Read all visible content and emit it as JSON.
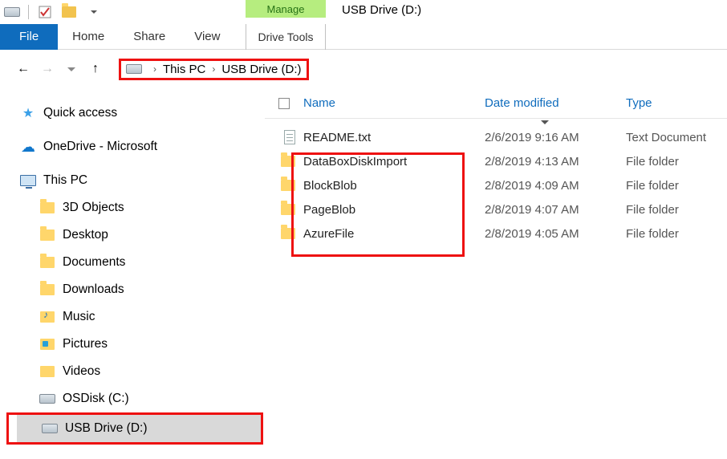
{
  "title": "USB Drive (D:)",
  "contextTab": {
    "label": "Manage",
    "group": "Drive Tools"
  },
  "ribbon": [
    "File",
    "Home",
    "Share",
    "View"
  ],
  "breadcrumb": [
    "This PC",
    "USB Drive (D:)"
  ],
  "columns": {
    "name": "Name",
    "date": "Date modified",
    "type": "Type"
  },
  "sidebar": {
    "quickAccess": "Quick access",
    "onedrive": "OneDrive - Microsoft",
    "thisPC": "This PC",
    "children": [
      "3D Objects",
      "Desktop",
      "Documents",
      "Downloads",
      "Music",
      "Pictures",
      "Videos",
      "OSDisk (C:)",
      "USB Drive (D:)"
    ]
  },
  "rows": [
    {
      "name": "README.txt",
      "date": "2/6/2019 9:16 AM",
      "type": "Text Document",
      "icon": "file"
    },
    {
      "name": "DataBoxDiskImport",
      "date": "2/8/2019 4:13 AM",
      "type": "File folder",
      "icon": "folder"
    },
    {
      "name": "BlockBlob",
      "date": "2/8/2019 4:09 AM",
      "type": "File folder",
      "icon": "folder"
    },
    {
      "name": "PageBlob",
      "date": "2/8/2019 4:07 AM",
      "type": "File folder",
      "icon": "folder"
    },
    {
      "name": "AzureFile",
      "date": "2/8/2019 4:05 AM",
      "type": "File folder",
      "icon": "folder"
    }
  ]
}
